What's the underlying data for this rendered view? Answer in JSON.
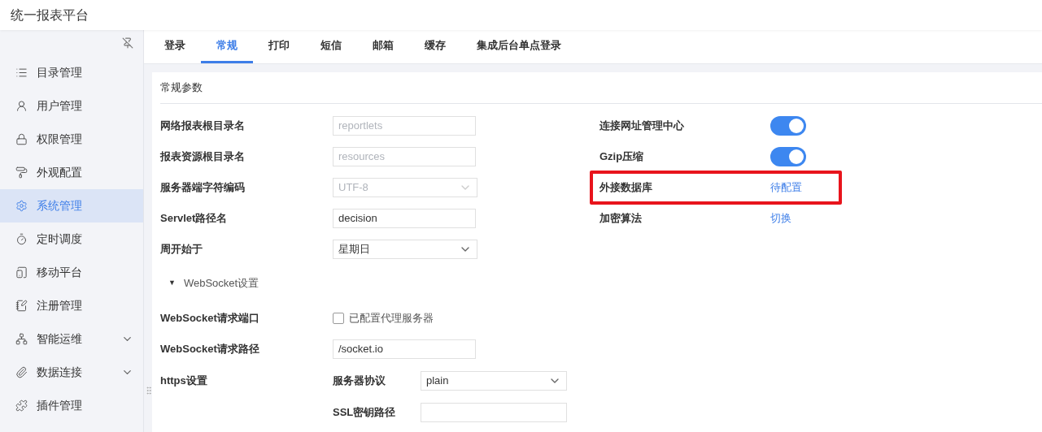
{
  "app_title": "统一报表平台",
  "sidebar": {
    "items": [
      {
        "label": "目录管理",
        "selected": false,
        "expandable": false
      },
      {
        "label": "用户管理",
        "selected": false,
        "expandable": false
      },
      {
        "label": "权限管理",
        "selected": false,
        "expandable": false
      },
      {
        "label": "外观配置",
        "selected": false,
        "expandable": false
      },
      {
        "label": "系统管理",
        "selected": true,
        "expandable": false
      },
      {
        "label": "定时调度",
        "selected": false,
        "expandable": false
      },
      {
        "label": "移动平台",
        "selected": false,
        "expandable": false
      },
      {
        "label": "注册管理",
        "selected": false,
        "expandable": false
      },
      {
        "label": "智能运维",
        "selected": false,
        "expandable": true
      },
      {
        "label": "数据连接",
        "selected": false,
        "expandable": true
      },
      {
        "label": "插件管理",
        "selected": false,
        "expandable": false
      }
    ]
  },
  "tabs": [
    {
      "label": "登录",
      "selected": false
    },
    {
      "label": "常规",
      "selected": true
    },
    {
      "label": "打印",
      "selected": false
    },
    {
      "label": "短信",
      "selected": false
    },
    {
      "label": "邮箱",
      "selected": false
    },
    {
      "label": "缓存",
      "selected": false
    },
    {
      "label": "集成后台单点登录",
      "selected": false
    }
  ],
  "panel": {
    "title": "常规参数",
    "left_rows": [
      {
        "kind": "input",
        "label": "网络报表根目录名",
        "value": "reportlets",
        "disabled": true
      },
      {
        "kind": "input",
        "label": "报表资源根目录名",
        "value": "resources",
        "disabled": true
      },
      {
        "kind": "select",
        "label": "服务器端字符编码",
        "value": "UTF-8",
        "disabled": true
      },
      {
        "kind": "input",
        "label": "Servlet路径名",
        "value": "decision",
        "disabled": false
      },
      {
        "kind": "select",
        "label": "周开始于",
        "value": "星期日",
        "disabled": false
      },
      {
        "kind": "section",
        "caret": "▼",
        "label": "WebSocket设置",
        "expanded": true
      },
      {
        "kind": "checkbox",
        "label": "WebSocket请求端口",
        "option": "已配置代理服务器",
        "checked": false
      },
      {
        "kind": "input",
        "label": "WebSocket请求路径",
        "value": "/socket.io",
        "disabled": false
      },
      {
        "kind": "group",
        "label": "https设置",
        "fields": [
          {
            "kind": "select",
            "label": "服务器协议",
            "value": "plain",
            "disabled": false
          },
          {
            "kind": "input",
            "label": "SSL密钥路径"
          }
        ]
      }
    ],
    "right_rows": [
      {
        "kind": "toggle",
        "label": "连接网址管理中心",
        "on": true,
        "highlighted": false
      },
      {
        "kind": "toggle",
        "label": "Gzip压缩",
        "on": true,
        "highlighted": false
      },
      {
        "kind": "link",
        "label": "外接数据库",
        "link": "待配置",
        "highlighted": true
      },
      {
        "kind": "link",
        "label": "加密算法",
        "link": "切换",
        "highlighted": false
      }
    ]
  }
}
